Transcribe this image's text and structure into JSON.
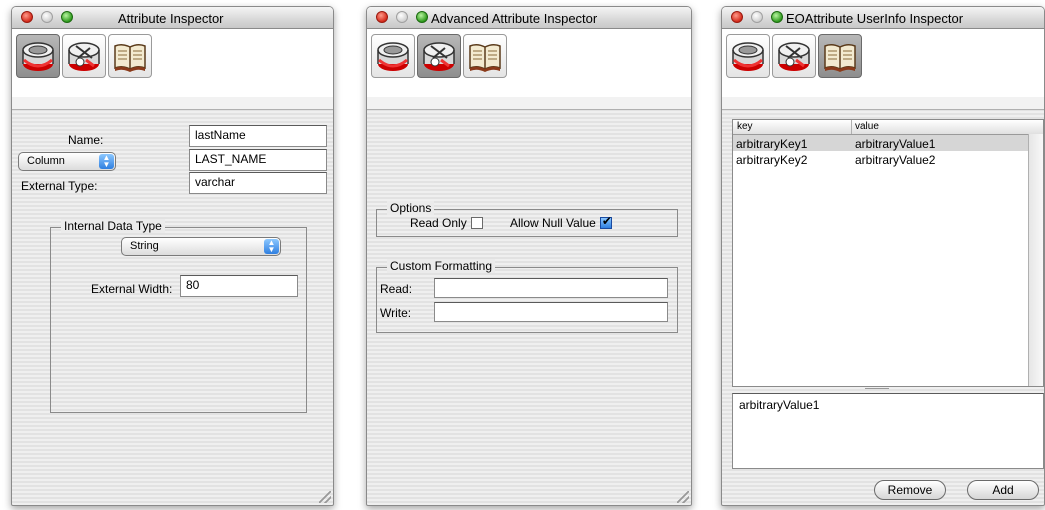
{
  "windows": {
    "attribute": {
      "title": "Attribute Inspector",
      "name_label": "Name:",
      "name_value": "lastName",
      "column_popup": "Column",
      "column_value": "LAST_NAME",
      "external_type_label": "External Type:",
      "external_type_value": "varchar",
      "internal_data_type_title": "Internal Data Type",
      "data_type_popup": "String",
      "external_width_label": "External Width:",
      "external_width_value": "80"
    },
    "advanced": {
      "title": "Advanced Attribute Inspector",
      "options_title": "Options",
      "read_only_label": "Read Only",
      "read_only_checked": false,
      "allow_null_label": "Allow Null Value",
      "allow_null_checked": true,
      "custom_formatting_title": "Custom Formatting",
      "read_label": "Read:",
      "read_value": "",
      "write_label": "Write:",
      "write_value": ""
    },
    "userinfo": {
      "title": "EOAttribute UserInfo Inspector",
      "columns": [
        "key",
        "value"
      ],
      "rows": [
        {
          "key": "arbitraryKey1",
          "value": "arbitraryValue1"
        },
        {
          "key": "arbitraryKey2",
          "value": "arbitraryValue2"
        }
      ],
      "detail_text": "arbitraryValue1",
      "remove_label": "Remove",
      "add_label": "Add"
    }
  },
  "toolbar_icons": [
    "attribute-icon",
    "advanced-attribute-icon",
    "userinfo-book-icon"
  ],
  "colors": {
    "selection_row": "#d6d6d6",
    "accent_blue": "#2f7fe0",
    "close_red": "#d42a1a",
    "zoom_green": "#2e9a1c"
  }
}
